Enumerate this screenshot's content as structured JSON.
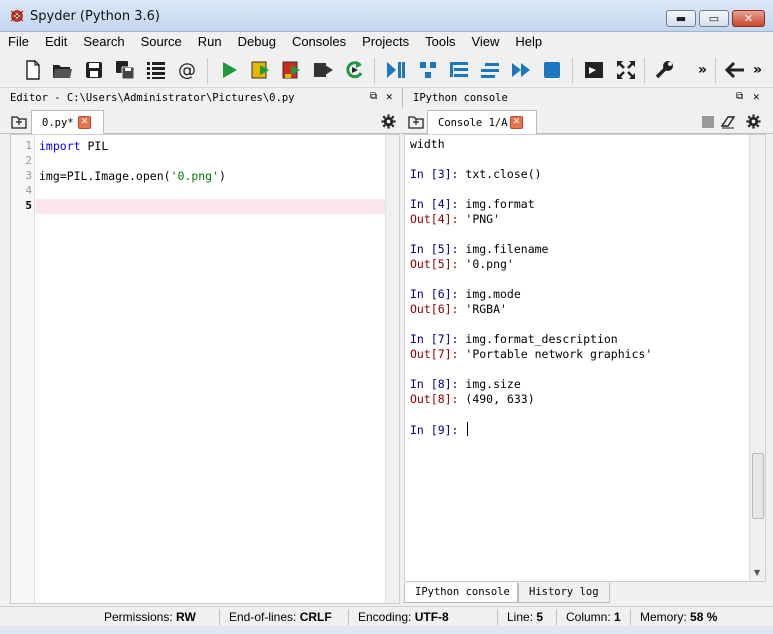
{
  "window": {
    "title": "Spyder (Python 3.6)",
    "controls": {
      "minimize": "▬",
      "maximize": "▭",
      "close": "✕"
    }
  },
  "menu": [
    "File",
    "Edit",
    "Search",
    "Source",
    "Run",
    "Debug",
    "Consoles",
    "Projects",
    "Tools",
    "View",
    "Help"
  ],
  "toolbar": {
    "more_left": "»",
    "more_right": "»"
  },
  "editor": {
    "header": "Editor - C:\\Users\\Administrator\\Pictures\\0.py",
    "tab_label": "0.py*",
    "tab_close": "✕",
    "line_numbers": [
      "1",
      "2",
      "3",
      "4",
      "5"
    ],
    "current_line": "5",
    "lines": {
      "l1_kw": "import",
      "l1_rest": " PIL",
      "l3_pre": "img=PIL.Image.open(",
      "l3_str": "'0.png'",
      "l3_post": ")"
    }
  },
  "console": {
    "header": "IPython console",
    "tab_label": "Console 1/A",
    "tab_close": "✕",
    "lines": [
      {
        "kind": "plain",
        "text": "width"
      },
      {
        "kind": "in",
        "prompt": "In [3]: ",
        "text": "txt.close()"
      },
      {
        "kind": "in",
        "prompt": "In [4]: ",
        "text": "img.format"
      },
      {
        "kind": "out",
        "prompt": "Out[4]: ",
        "text": "'PNG'"
      },
      {
        "kind": "in",
        "prompt": "In [5]: ",
        "text": "img.filename"
      },
      {
        "kind": "out",
        "prompt": "Out[5]: ",
        "text": "'0.png'"
      },
      {
        "kind": "in",
        "prompt": "In [6]: ",
        "text": "img.mode"
      },
      {
        "kind": "out",
        "prompt": "Out[6]: ",
        "text": "'RGBA'"
      },
      {
        "kind": "in",
        "prompt": "In [7]: ",
        "text": "img.format_description"
      },
      {
        "kind": "out",
        "prompt": "Out[7]: ",
        "text": "'Portable network graphics'"
      },
      {
        "kind": "in",
        "prompt": "In [8]: ",
        "text": "img.size"
      },
      {
        "kind": "out",
        "prompt": "Out[8]: ",
        "text": "(490, 633)"
      },
      {
        "kind": "in",
        "prompt": "In [9]: ",
        "text": ""
      }
    ],
    "bottom_tabs": [
      "IPython console",
      "History log"
    ]
  },
  "status": {
    "permissions_label": "Permissions:",
    "permissions_value": "RW",
    "eol_label": "End-of-lines:",
    "eol_value": "CRLF",
    "encoding_label": "Encoding:",
    "encoding_value": "UTF-8",
    "line_label": "Line:",
    "line_value": "5",
    "column_label": "Column:",
    "column_value": "1",
    "memory_label": "Memory:",
    "memory_value": "58 %"
  },
  "colors": {
    "keyword": "#0000ff",
    "string": "#008000",
    "prompt_in": "#000080",
    "prompt_out": "#8b0000",
    "current_line": "#fbe6f0"
  }
}
